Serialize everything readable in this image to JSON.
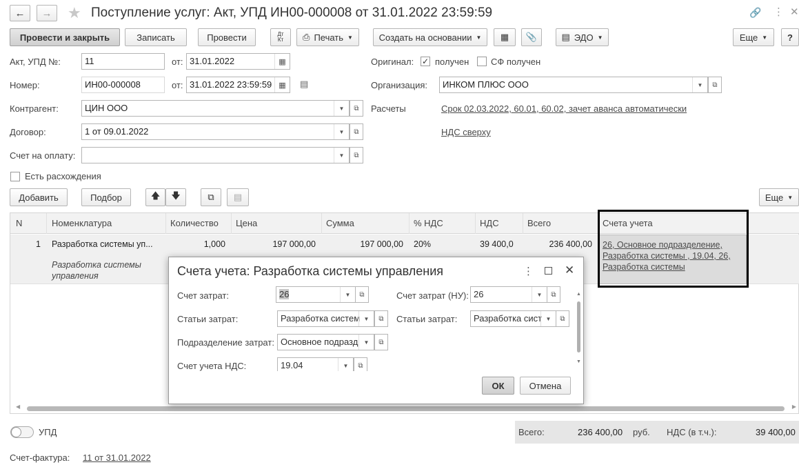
{
  "window": {
    "title": "Поступление услуг: Акт, УПД ИН00-000008 от 31.01.2022 23:59:59"
  },
  "toolbar": {
    "post_close": "Провести и закрыть",
    "save": "Записать",
    "post": "Провести",
    "dtkt": "Дт Кт",
    "print": "Печать",
    "create_based": "Создать на основании",
    "edo": "ЭДО",
    "more": "Еще",
    "help": "?"
  },
  "header": {
    "act_label": "Акт, УПД №:",
    "act_number": "11",
    "from_label": "от:",
    "act_date": "31.01.2022",
    "number_label": "Номер:",
    "number": "ИН00-000008",
    "number_date": "31.01.2022 23:59:59",
    "counterparty_label": "Контрагент:",
    "counterparty": "ЦИН ООО",
    "contract_label": "Договор:",
    "contract": "1 от 09.01.2022",
    "invoice_label": "Счет на оплату:",
    "invoice": "",
    "discrepancy_label": "Есть расхождения",
    "original_label": "Оригинал:",
    "received_label": "получен",
    "received_checked": true,
    "sf_received_label": "СФ получен",
    "sf_received_checked": false,
    "org_label": "Организация:",
    "organization": "ИНКОМ ПЛЮС ООО",
    "settlements_label": "Расчеты",
    "settlements_link": "Срок 02.03.2022, 60.01, 60.02, зачет аванса автоматически",
    "vat_link": "НДС сверху"
  },
  "table_toolbar": {
    "add": "Добавить",
    "select": "Подбор",
    "more": "Еще"
  },
  "table": {
    "columns": [
      "N",
      "Номенклатура",
      "Количество",
      "Цена",
      "Сумма",
      "% НДС",
      "НДС",
      "Всего",
      "Счета учета"
    ],
    "rows": [
      {
        "n": "1",
        "item": "Разработка системы уп...",
        "item_desc": "Разработка системы управления",
        "qty": "1,000",
        "price": "197 000,00",
        "sum": "197 000,00",
        "vat_rate": "20%",
        "vat": "39 400,0",
        "total": "236 400,00",
        "accounts": "26, Основное подразделение, Разработка системы , 19.04, 26, Разработка системы"
      }
    ]
  },
  "modal": {
    "title": "Счета учета: Разработка системы управления",
    "cost_account_label": "Счет затрат:",
    "cost_account": "26",
    "cost_account_nu_label": "Счет затрат (НУ):",
    "cost_account_nu": "26",
    "cost_items_label": "Статьи затрат:",
    "cost_items": "Разработка систем",
    "cost_items_nu_label": "Статьи затрат:",
    "cost_items_nu": "Разработка сист",
    "division_label": "Подразделение затрат:",
    "division": "Основное подразд",
    "vat_account_label": "Счет учета НДС:",
    "vat_account": "19.04",
    "ok": "ОК",
    "cancel": "Отмена"
  },
  "footer": {
    "upd_label": "УПД",
    "upd_on": false,
    "total_label": "Всего:",
    "total": "236 400,00",
    "currency": "руб.",
    "vat_label": "НДС (в т.ч.):",
    "vat": "39 400,00",
    "invoice_label": "Счет-фактура:",
    "invoice_link": "11 от 31.01.2022"
  },
  "colors": {
    "highlight_border": "#000000",
    "selected_row": "#f0f0f0",
    "total_bg": "#e6e6e6"
  }
}
